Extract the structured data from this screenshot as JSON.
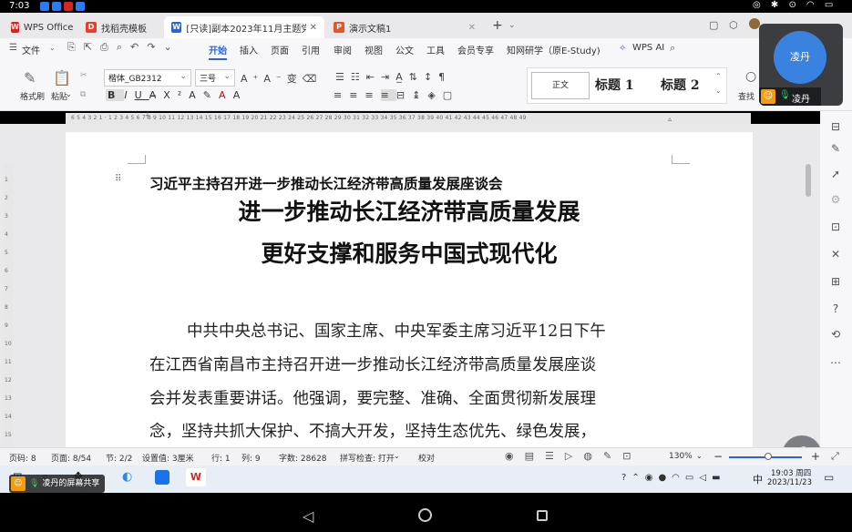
{
  "status": {
    "time": "7:03",
    "icons": [
      "status-icon",
      "status-icon",
      "status-icon",
      "status-icon",
      "status-icon"
    ],
    "right_icons": "◎ ✱ ⊙ ◠ ▭"
  },
  "tabs": [
    {
      "label": "WPS Office",
      "color": "#d9251d",
      "glyph": "W"
    },
    {
      "label": "找稻壳模板",
      "color": "#e5402b",
      "glyph": "D"
    },
    {
      "label": "[只读]副本2023年11月主题党日活",
      "color": "#2a64d6",
      "glyph": "W"
    },
    {
      "label": "演示文稿1",
      "color": "#e5552b",
      "glyph": "P"
    }
  ],
  "menu": {
    "file": "文件",
    "items": [
      "开始",
      "插入",
      "页面",
      "引用",
      "审阅",
      "视图",
      "公文",
      "工具",
      "会员专享",
      "知网研学（原E-Study)"
    ],
    "ai": "WPS AI"
  },
  "ribbon": {
    "format_painter": "格式刷",
    "paste": "粘贴",
    "font": "楷体_GB2312",
    "size": "三号",
    "style_normal": "正文",
    "style_h1": "标题 1",
    "style_h2": "标题 2",
    "find": "查找"
  },
  "meeting": {
    "avatar": "凌丹",
    "name": "凌丹"
  },
  "ruler": {
    "top": "6 5 4 3 2 1 · 1 2 3 4 5 6 7 8 9 10 11 12 13 14 15 16 17 18 19 20 21 22 23 24 25 26 27 28 29 30 31 32 33 34 35 36 37 38 39 40 41 42 43 44 45 46 47 48 49",
    "left": [
      "1",
      "2",
      "3",
      "4",
      "5",
      "6",
      "7",
      "8",
      "9",
      "10",
      "11",
      "12",
      "13",
      "14",
      "15"
    ]
  },
  "doc": {
    "heading": "习近平主持召开进一步推动长江经济带高质量发展座谈会",
    "title1": "进一步推动长江经济带高质量发展",
    "title2": "更好支撑和服务中国式现代化",
    "lines": [
      "中共中央总书记、国家主席、中央军委主席习近平12日下午",
      "在江西省南昌市主持召开进一步推动长江经济带高质量发展座谈",
      "会并发表重要讲话。他强调，要完整、准确、全面贯彻新发展理",
      "念，坚持共抓大保护、不搞大开发，坚持生态优先、绿色发展，"
    ]
  },
  "pstatus": {
    "page_num": "页码: 8",
    "pages": "页面: 8/54",
    "section": "节: 2/2",
    "setting": "设置值: 3厘米",
    "row": "行: 1",
    "col": "列: 9",
    "words": "字数: 28628",
    "spell": "拼写检查: 打开",
    "proof": "校对",
    "zoom": "130%"
  },
  "taskbar": {
    "share": "凌丹的屏幕共享",
    "time": "19:03",
    "weekday": "周四",
    "date": "2023/11/23",
    "ime": "中"
  }
}
